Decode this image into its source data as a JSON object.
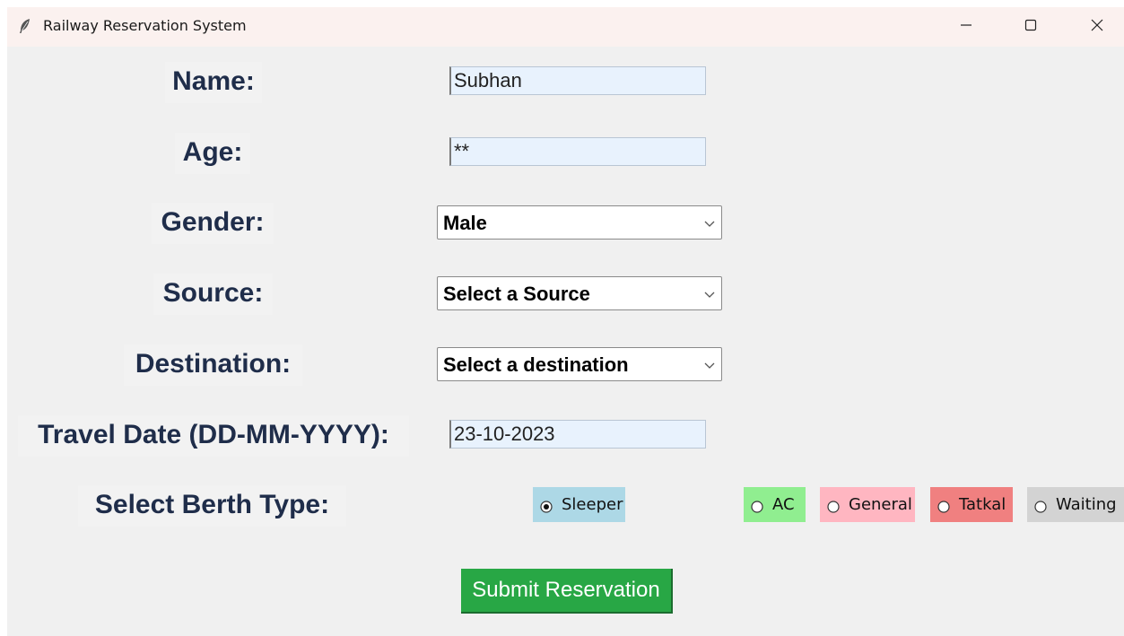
{
  "window": {
    "title": "Railway Reservation System",
    "icon": "feather-icon",
    "controls": [
      "minimize-icon",
      "maximize-icon",
      "close-icon"
    ]
  },
  "form": {
    "name": {
      "label": "Name:",
      "value": "Subhan"
    },
    "age": {
      "label": "Age:",
      "value": "**"
    },
    "gender": {
      "label": "Gender:",
      "value": "Male"
    },
    "source": {
      "label": "Source:",
      "value": "Select a Source"
    },
    "destination": {
      "label": "Destination:",
      "value": "Select a destination"
    },
    "travel_date": {
      "label": "Travel Date (DD-MM-YYYY):",
      "value": "23-10-2023"
    },
    "berth": {
      "label": "Select Berth Type:",
      "selected": "Sleeper",
      "options": [
        {
          "label": "Sleeper",
          "color": "#add8e6"
        },
        {
          "label": "AC",
          "color": "#90ee90"
        },
        {
          "label": "General",
          "color": "#ffb6c1"
        },
        {
          "label": "Tatkal",
          "color": "#f08080"
        },
        {
          "label": "Waiting",
          "color": "#d3d3d3"
        }
      ]
    },
    "submit_label": "Submit Reservation"
  },
  "colors": {
    "label_text": "#1f2d4a",
    "submit_bg": "#28a745",
    "entry_bg": "#e8f2fd"
  }
}
